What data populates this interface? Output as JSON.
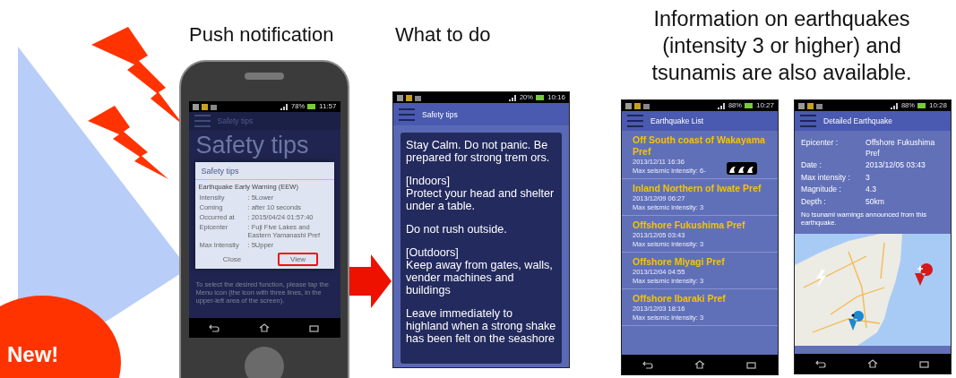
{
  "badge": {
    "text": "New!"
  },
  "push_notification": {
    "caption": "Push notification",
    "phone": {
      "status_bar": {
        "battery": "78%",
        "time": "11:57"
      },
      "app_bar_title": "Safety tips",
      "background_title": "Safety tips",
      "background_text": "To select the desired function, please tap the Menu icon (the icon with three lines, in the upper-left area of the screen).",
      "dialog": {
        "title": "Safety tips",
        "subtitle": "Earthquake Early Warning (EEW)",
        "rows": [
          {
            "label": "Intensity",
            "value": ": 5Lower"
          },
          {
            "label": "Coming",
            "value": ": after 10 seconds"
          },
          {
            "label": "Occurred at",
            "value": ": 2015/04/24 01:57:40"
          },
          {
            "label": "Epicenter",
            "value": ": Fuji Five Lakes and Eastern Yamanashi Pref"
          },
          {
            "label": "Max Intensity",
            "value": ": 5Upper"
          }
        ],
        "buttons": [
          {
            "label": "Close",
            "highlighted": false
          },
          {
            "label": "View",
            "highlighted": true
          }
        ]
      }
    }
  },
  "what_to_do": {
    "caption": "What to do",
    "phone": {
      "status_bar": {
        "battery": "20%",
        "time": "10:16"
      },
      "app_bar_title": "Safety tips",
      "paragraphs": [
        "Stay Calm. Do not panic. Be prepared for strong trem ors.",
        "[Indoors]\nProtect your head and shelter under a table.",
        "Do not rush outside.",
        "[Outdoors]\nKeep away from gates, walls, vender machines and buildings",
        "Leave immediately to highland when a strong shake has been felt on the seashore"
      ]
    }
  },
  "information": {
    "caption": "Information on earthquakes (intensity 3 or higher) and tsunamis are also available.",
    "list_screen": {
      "status_bar": {
        "battery": "88%",
        "time": "10:27"
      },
      "app_bar_title": "Earthquake List",
      "items": [
        {
          "title": "Off South coast of Wakayama Pref",
          "date": "2013/12/11 16:36",
          "intensity": "Max seismic intensity: 6-",
          "tsunami": true
        },
        {
          "title": "Inland Northern of Iwate Pref",
          "date": "2013/12/09 06:27",
          "intensity": "Max seismic intensity: 3",
          "tsunami": false
        },
        {
          "title": "Offshore Fukushima Pref",
          "date": "2013/12/05 03:43",
          "intensity": "Max seismic intensity: 3",
          "tsunami": false
        },
        {
          "title": "Offshore Miyagi Pref",
          "date": "2013/12/04 04:55",
          "intensity": "Max seismic intensity: 3",
          "tsunami": false
        },
        {
          "title": "Offshore Ibaraki Pref",
          "date": "2013/12/03 18:16",
          "intensity": "Max seismic intensity: 3",
          "tsunami": false
        }
      ]
    },
    "detail_screen": {
      "status_bar": {
        "battery": "88%",
        "time": "10:28"
      },
      "app_bar_title": "Detailed Earthquake",
      "fields": [
        {
          "label": "Epicenter :",
          "value": "Offshore Fukushima Pref"
        },
        {
          "label": "Date :",
          "value": "2013/12/05 03:43"
        },
        {
          "label": "Max intensity :",
          "value": "3"
        },
        {
          "label": "Magnitude :",
          "value": "4.3"
        },
        {
          "label": "Depth :",
          "value": "50km"
        }
      ],
      "note": "No tsunami warnings announced from this earthquake."
    }
  }
}
